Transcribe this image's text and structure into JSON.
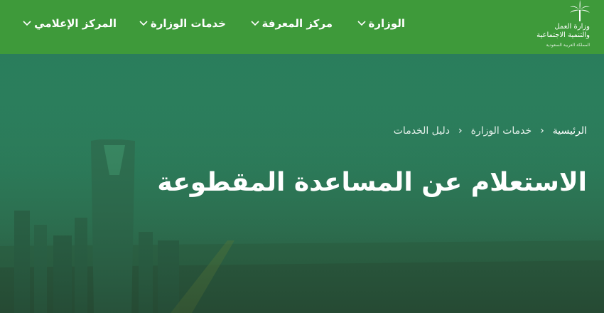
{
  "header": {
    "logo": {
      "line1": "وزارة العمل",
      "line2": "والتنمية الاجتماعية",
      "line3": "المملكة العربية السعودية"
    },
    "menu": [
      {
        "label": "الوزارة",
        "icon": "chevron-down-icon"
      },
      {
        "label": "مركز المعرفة",
        "icon": "chevron-down-icon"
      },
      {
        "label": "خدمات الوزارة",
        "icon": "chevron-down-icon"
      },
      {
        "label": "المركز الإعلامي",
        "icon": "chevron-down-icon"
      }
    ]
  },
  "breadcrumb": {
    "items": [
      "الرئيسية",
      "خدمات الوزارة",
      "دليل الخدمات"
    ]
  },
  "page": {
    "title": "الاستعلام عن المساعدة المقطوعة"
  },
  "colors": {
    "header_bg": "#3e9a3a",
    "hero_bg": "#2a7d5c",
    "text": "#ffffff"
  }
}
